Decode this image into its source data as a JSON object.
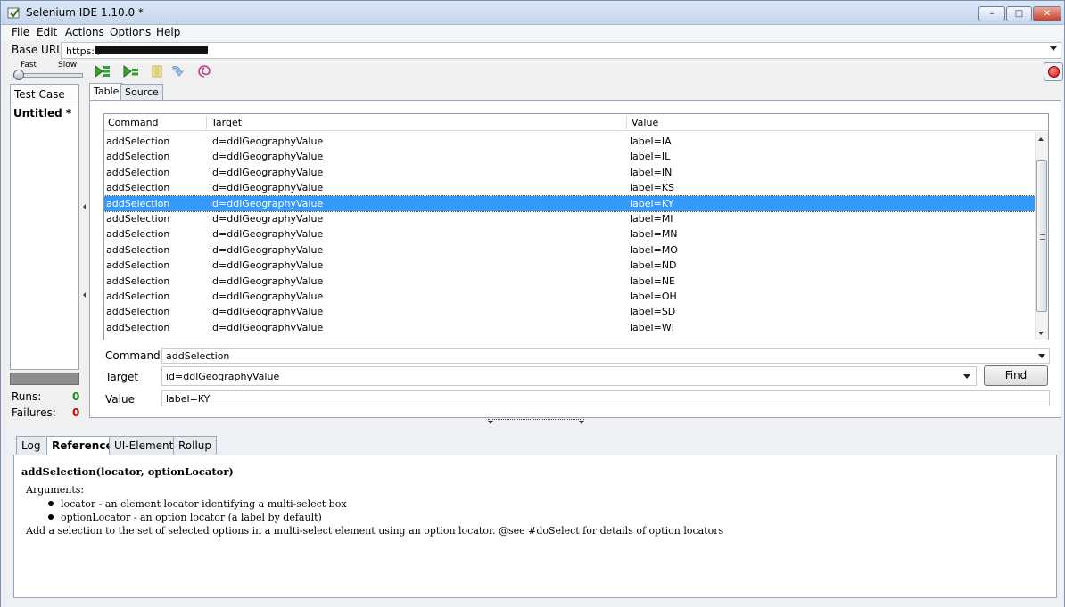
{
  "window": {
    "title": "Selenium IDE 1.10.0 *"
  },
  "menu": [
    "File",
    "Edit",
    "Actions",
    "Options",
    "Help"
  ],
  "base_url": {
    "label": "Base URL",
    "value": "https://"
  },
  "speed": {
    "fast_label": "Fast",
    "slow_label": "Slow"
  },
  "toolbar_icons": [
    "play-suite-icon",
    "play-test-icon",
    "pause-icon",
    "step-icon",
    "rollup-icon",
    "record-icon"
  ],
  "test_case": {
    "header": "Test Case",
    "items": [
      "Untitled *"
    ]
  },
  "stats": {
    "runs_label": "Runs:",
    "runs_value": "0",
    "failures_label": "Failures:",
    "failures_value": "0"
  },
  "editor_tabs": [
    "Table",
    "Source"
  ],
  "table": {
    "columns": [
      "Command",
      "Target",
      "Value"
    ],
    "selected_index": 4,
    "rows": [
      [
        "addSelection",
        "id=ddlGeographyValue",
        "label=IA"
      ],
      [
        "addSelection",
        "id=ddlGeographyValue",
        "label=IL"
      ],
      [
        "addSelection",
        "id=ddlGeographyValue",
        "label=IN"
      ],
      [
        "addSelection",
        "id=ddlGeographyValue",
        "label=KS"
      ],
      [
        "addSelection",
        "id=ddlGeographyValue",
        "label=KY"
      ],
      [
        "addSelection",
        "id=ddlGeographyValue",
        "label=MI"
      ],
      [
        "addSelection",
        "id=ddlGeographyValue",
        "label=MN"
      ],
      [
        "addSelection",
        "id=ddlGeographyValue",
        "label=MO"
      ],
      [
        "addSelection",
        "id=ddlGeographyValue",
        "label=ND"
      ],
      [
        "addSelection",
        "id=ddlGeographyValue",
        "label=NE"
      ],
      [
        "addSelection",
        "id=ddlGeographyValue",
        "label=OH"
      ],
      [
        "addSelection",
        "id=ddlGeographyValue",
        "label=SD"
      ],
      [
        "addSelection",
        "id=ddlGeographyValue",
        "label=WI"
      ]
    ]
  },
  "form": {
    "command_label": "Command",
    "command_value": "addSelection",
    "target_label": "Target",
    "target_value": "id=ddlGeographyValue",
    "value_label": "Value",
    "value_value": "label=KY",
    "find_label": "Find"
  },
  "bottom_tabs": [
    "Log",
    "Reference",
    "UI-Element",
    "Rollup"
  ],
  "reference": {
    "title": "addSelection(locator, optionLocator)",
    "args_label": "Arguments:",
    "args": [
      "locator - an element locator identifying a multi-select box",
      "optionLocator - an option locator (a label by default)"
    ],
    "description": "Add a selection to the set of selected options in a multi-select element using an option locator. @see #doSelect for details of option locators"
  },
  "colors": {
    "selection": "#3399ff",
    "runs": "#1a8a1a",
    "failures": "#dd0000",
    "record": "#dd1111"
  }
}
